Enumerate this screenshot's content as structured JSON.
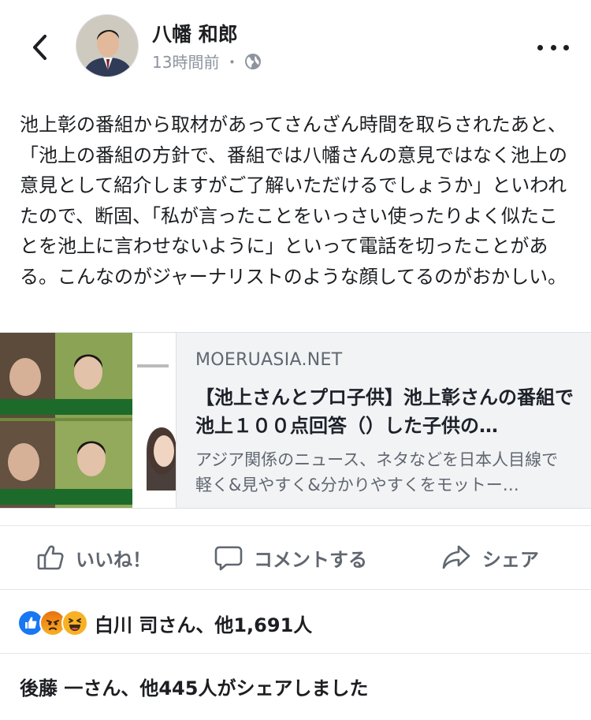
{
  "post": {
    "author": "八幡 和郎",
    "time": "13時間前",
    "dot": "・",
    "text": "池上彰の番組から取材があってさんざん時間を取らされたあと、「池上の番組の方針で、番組では八幡さんの意見ではなく池上の意見として紹介しますがご了解いただけるでしょうか」といわれたので、断固、「私が言ったことをいっさい使ったりよく似たことを池上に言わせないように」といって電話を切ったことがある。こんなのがジャーナリストのような顔してるのがおかしい。"
  },
  "link": {
    "domain": "MOERUASIA.NET",
    "title": "【池上さんとプロ子供】池上彰さんの番組で池上１００点回答（）した子供の…",
    "description": "アジア関係のニュース、ネタなどを日本人目線で軽く&見やすく&分かりやすくをモットー…"
  },
  "actions": {
    "like": "いいね！",
    "comment": "コメントする",
    "share": "シェア"
  },
  "reactions": {
    "icons": [
      "like-icon",
      "angry-icon",
      "haha-icon"
    ],
    "summary": "白川 司さん、他1,691人"
  },
  "shares_text": "後藤 一さん、他445人がシェアしました",
  "colors": {
    "like_blue": "#1877f2",
    "reaction_yellow": "#f7b125",
    "angry_red": "#e9710f",
    "muted_text": "#606770"
  }
}
